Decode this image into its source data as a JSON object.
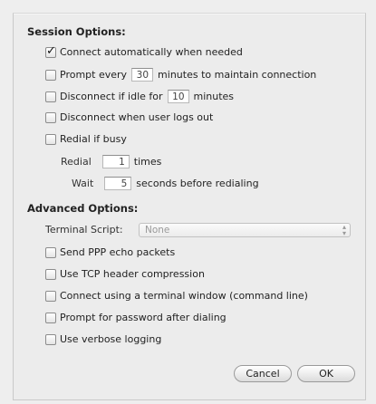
{
  "session": {
    "title": "Session Options:",
    "connect_auto": "Connect automatically when needed",
    "prompt_prefix": "Prompt every",
    "prompt_value": "30",
    "prompt_suffix": "minutes to maintain connection",
    "idle_prefix": "Disconnect if idle for",
    "idle_value": "10",
    "idle_suffix": "minutes",
    "logout": "Disconnect when user logs out",
    "redial": "Redial if busy",
    "redial_label": "Redial",
    "redial_value": "1",
    "redial_suffix": "times",
    "wait_label": "Wait",
    "wait_value": "5",
    "wait_suffix": "seconds before redialing"
  },
  "advanced": {
    "title": "Advanced Options:",
    "terminal_label": "Terminal Script:",
    "terminal_value": "None",
    "echo": "Send PPP echo packets",
    "tcp": "Use TCP header compression",
    "terminal_window": "Connect using a terminal window (command line)",
    "prompt_password": "Prompt for password after dialing",
    "verbose": "Use verbose logging"
  },
  "buttons": {
    "cancel": "Cancel",
    "ok": "OK"
  },
  "checkbox_states": {
    "connect_auto": true,
    "prompt_every": false,
    "idle": false,
    "logout": false,
    "redial": false,
    "echo": false,
    "tcp": false,
    "terminal_window": false,
    "prompt_password": false,
    "verbose": false
  }
}
